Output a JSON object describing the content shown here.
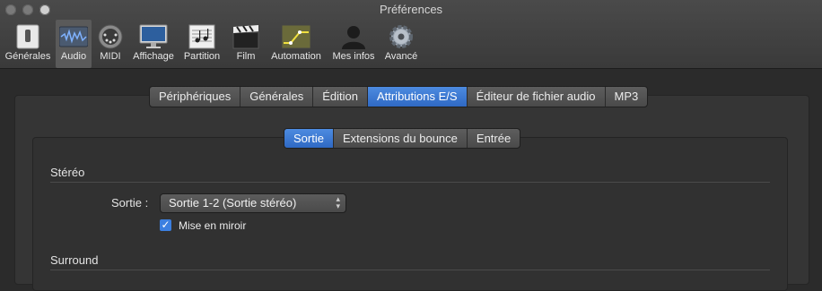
{
  "window": {
    "title": "Préférences"
  },
  "toolbar": {
    "items": [
      {
        "label": "Générales",
        "icon": "switch-icon"
      },
      {
        "label": "Audio",
        "icon": "audio-waveform-icon",
        "selected": true
      },
      {
        "label": "MIDI",
        "icon": "midi-connector-icon"
      },
      {
        "label": "Affichage",
        "icon": "monitor-icon"
      },
      {
        "label": "Partition",
        "icon": "music-score-icon"
      },
      {
        "label": "Film",
        "icon": "clapperboard-icon"
      },
      {
        "label": "Automation",
        "icon": "automation-curve-icon"
      },
      {
        "label": "Mes infos",
        "icon": "user-silhouette-icon"
      },
      {
        "label": "Avancé",
        "icon": "gear-icon"
      }
    ]
  },
  "tabs": {
    "items": [
      "Périphériques",
      "Générales",
      "Édition",
      "Attributions E/S",
      "Éditeur de fichier audio",
      "MP3"
    ],
    "selected": "Attributions E/S"
  },
  "subtabs": {
    "items": [
      "Sortie",
      "Extensions du bounce",
      "Entrée"
    ],
    "selected": "Sortie"
  },
  "stereo": {
    "heading": "Stéréo",
    "output_label": "Sortie :",
    "output_value": "Sortie 1-2 (Sortie stéréo)",
    "mirror_label": "Mise en miroir",
    "mirror_checked": true
  },
  "surround": {
    "heading": "Surround"
  }
}
